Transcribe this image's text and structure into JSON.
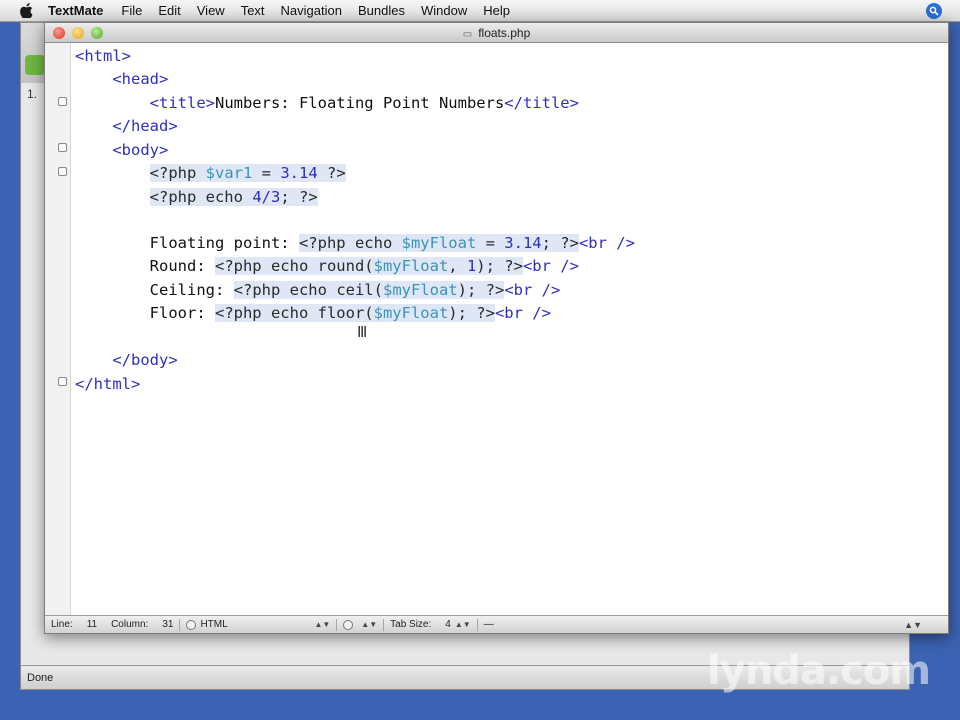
{
  "menubar": {
    "apple_icon": "apple-icon",
    "app_name": "TextMate",
    "items": [
      "File",
      "Edit",
      "View",
      "Text",
      "Navigation",
      "Bundles",
      "Window",
      "Help"
    ]
  },
  "background_window": {
    "partial_number": "1.",
    "status_text": "Done"
  },
  "window": {
    "title": "floats.php"
  },
  "code": {
    "l1": {
      "t1": "<html>"
    },
    "l2": {
      "indent": "    ",
      "t1": "<head>"
    },
    "l3": {
      "indent": "        ",
      "t1": "<title>",
      "t2": "Numbers: Floating Point Numbers",
      "t3": "</title>"
    },
    "l4": {
      "indent": "    ",
      "t1": "</head>"
    },
    "l5": {
      "indent": "    ",
      "t1": "<body>"
    },
    "l6": {
      "indent": "        ",
      "a": "<?php ",
      "b": "$var1",
      "c": " = ",
      "d": "3.14",
      "e": " ?>"
    },
    "l7": {
      "indent": "        ",
      "a": "<?php echo ",
      "b": "4/3",
      "c": "; ?>"
    },
    "l8": {
      "text": ""
    },
    "l9": {
      "indent": "        ",
      "label": "Floating point: ",
      "a": "<?php echo ",
      "b": "$myFloat",
      "c": " = ",
      "d": "3.14",
      "e": "; ?>",
      "f": "<br />"
    },
    "l10": {
      "indent": "        ",
      "label": "Round: ",
      "a": "<?php echo round(",
      "b": "$myFloat",
      "c": ", ",
      "d": "1",
      "e": "); ?>",
      "f": "<br />"
    },
    "l11": {
      "indent": "        ",
      "label": "Ceiling: ",
      "a": "<?php echo ",
      "b": "ceil(",
      "c": "$myFloat",
      "d": "); ?>",
      "f": "<br />"
    },
    "l12": {
      "indent": "        ",
      "label": "Floor: ",
      "a": "<?php echo floor(",
      "b": "$myFloat",
      "c": "); ?>",
      "f": "<br />"
    },
    "l13": {
      "text": ""
    },
    "l14": {
      "indent": "    ",
      "t1": "</body>"
    },
    "l15": {
      "t1": "</html>"
    }
  },
  "statusbar": {
    "line_label": "Line:",
    "line_value": "11",
    "column_label": "Column:",
    "column_value": "31",
    "language": "HTML",
    "tabsize_label": "Tab Size:",
    "tabsize_value": "4",
    "symbol": "—"
  },
  "watermark": "lynda.com",
  "colors": {
    "desktop": "#3c63b3",
    "tag": "#2e2ec0",
    "variable": "#3b94b8",
    "php_highlight": "#dfe6f6"
  }
}
